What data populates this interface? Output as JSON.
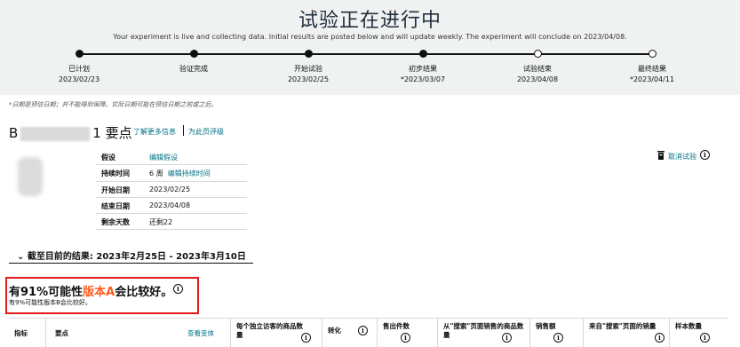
{
  "banner": {
    "title": "试验正在进行中",
    "subtitle": "Your experiment is live and collecting data. Initial results are posted below and will update weekly. The experiment will conclude on 2023/04/08."
  },
  "timeline": [
    {
      "label": "已计划",
      "date": "2023/02/23",
      "state": "done"
    },
    {
      "label": "验证完成",
      "date": "",
      "state": "done"
    },
    {
      "label": "开始试验",
      "date": "2023/02/25",
      "state": "done"
    },
    {
      "label": "初步结果",
      "date": "*2023/03/07",
      "state": "done"
    },
    {
      "label": "试验结束",
      "date": "2023/04/08",
      "state": "pending"
    },
    {
      "label": "最终结果",
      "date": "*2023/04/11",
      "state": "pending"
    }
  ],
  "note": "*日期是预估日期；并不能得到保障。实际日期可能在预估日期之前或之后。",
  "header": {
    "prefix": "B",
    "suffix": "1 要点",
    "learn_more": "了解更多信息",
    "rate_page": "为此页评级"
  },
  "info": {
    "hypothesis_label": "假设",
    "hypothesis_link": "编辑假设",
    "duration_label": "持续时间",
    "duration_value": "6 周",
    "duration_link": "编辑持续时间",
    "start_label": "开始日期",
    "start_value": "2023/02/25",
    "end_label": "结束日期",
    "end_value": "2023/04/08",
    "remaining_label": "剩余天数",
    "remaining_value": "还剩22"
  },
  "cancel_label": "取消试验",
  "results": {
    "header": "截至目前的结果: 2023年2月25日 - 2023年3月10日",
    "win_prefix": "有91%可能性",
    "win_variant": "版本A",
    "win_suffix": "会比较好。",
    "win_sub": "有9%可能性版本B会比较好。"
  },
  "metrics_table": {
    "col_metric": "指标",
    "col_point": "要点",
    "view_body": "查看变体",
    "col_sessions": "每个独立访客的商品数量",
    "col_conversion": "转化",
    "col_units": "售出件数",
    "col_search_units": "从\"搜索\"页面销售的商品数量",
    "col_sales": "销售额",
    "col_search_sales": "来自\"搜索\"页面的销量",
    "col_sample": "样本数量"
  },
  "colors": {
    "accent": "#ff5a1f",
    "link": "#007185",
    "highlight_box": "#e31a1a",
    "banner_bg": "#f0f2f2"
  }
}
